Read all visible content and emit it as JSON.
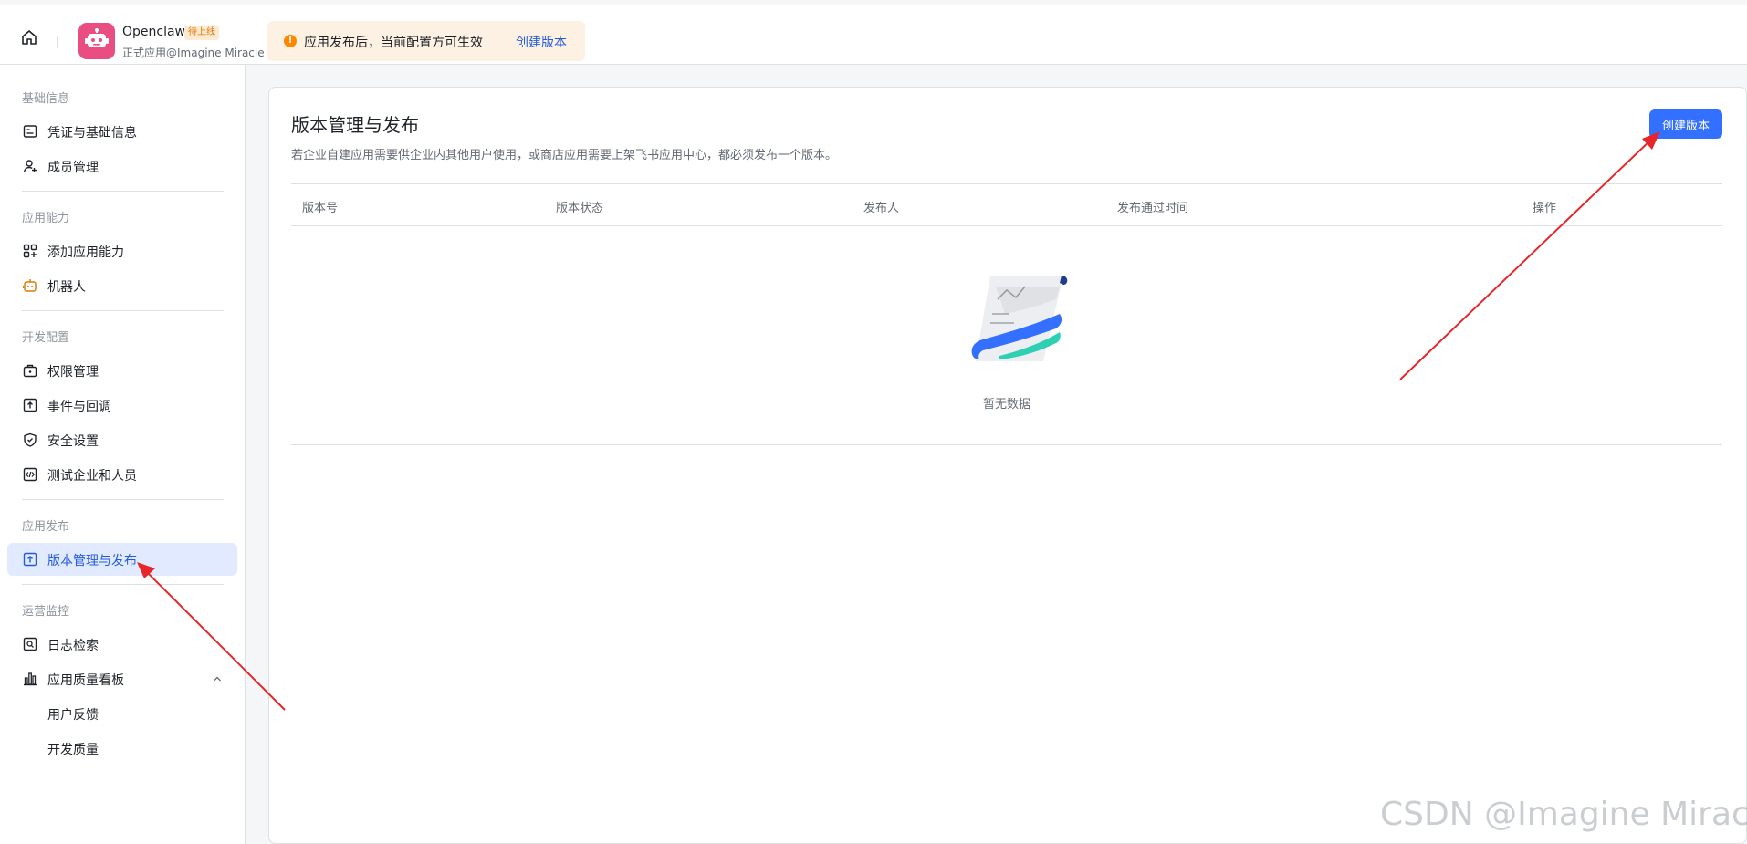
{
  "app": {
    "name": "Openclaw",
    "badge": "待上线",
    "subtitle": "正式应用@Imagine Miracle",
    "avatar_color": "#e94d82"
  },
  "notice": {
    "text": "应用发布后，当前配置方可生效",
    "link": "创建版本"
  },
  "sidebar": {
    "groups": [
      {
        "title": "基础信息",
        "items": [
          {
            "label": "凭证与基础信息",
            "icon": "credential-icon"
          },
          {
            "label": "成员管理",
            "icon": "member-icon"
          }
        ]
      },
      {
        "title": "应用能力",
        "items": [
          {
            "label": "添加应用能力",
            "icon": "add-capability-icon"
          },
          {
            "label": "机器人",
            "icon": "robot-icon"
          }
        ]
      },
      {
        "title": "开发配置",
        "items": [
          {
            "label": "权限管理",
            "icon": "permission-icon"
          },
          {
            "label": "事件与回调",
            "icon": "event-icon"
          },
          {
            "label": "安全设置",
            "icon": "shield-icon"
          },
          {
            "label": "测试企业和人员",
            "icon": "code-icon"
          }
        ]
      },
      {
        "title": "应用发布",
        "items": [
          {
            "label": "版本管理与发布",
            "icon": "upload-icon",
            "active": true
          }
        ]
      },
      {
        "title": "运营监控",
        "items": [
          {
            "label": "日志检索",
            "icon": "log-search-icon"
          },
          {
            "label": "应用质量看板",
            "icon": "chart-icon",
            "expanded": true,
            "children": [
              "用户反馈",
              "开发质量"
            ]
          }
        ]
      }
    ]
  },
  "main": {
    "title": "版本管理与发布",
    "description": "若企业自建应用需要供企业内其他用户使用，或商店应用需要上架飞书应用中心，都必须发布一个版本。",
    "create_button": "创建版本",
    "columns": [
      "版本号",
      "版本状态",
      "发布人",
      "发布通过时间",
      "操作"
    ],
    "rows": [],
    "empty_text": "暂无数据"
  },
  "watermark": "CSDN @Imagine Miracle",
  "colors": {
    "primary": "#3370ff",
    "link": "#245bdb",
    "annotation_arrow": "#e8262a",
    "notice_bg": "#fdf1e3"
  }
}
